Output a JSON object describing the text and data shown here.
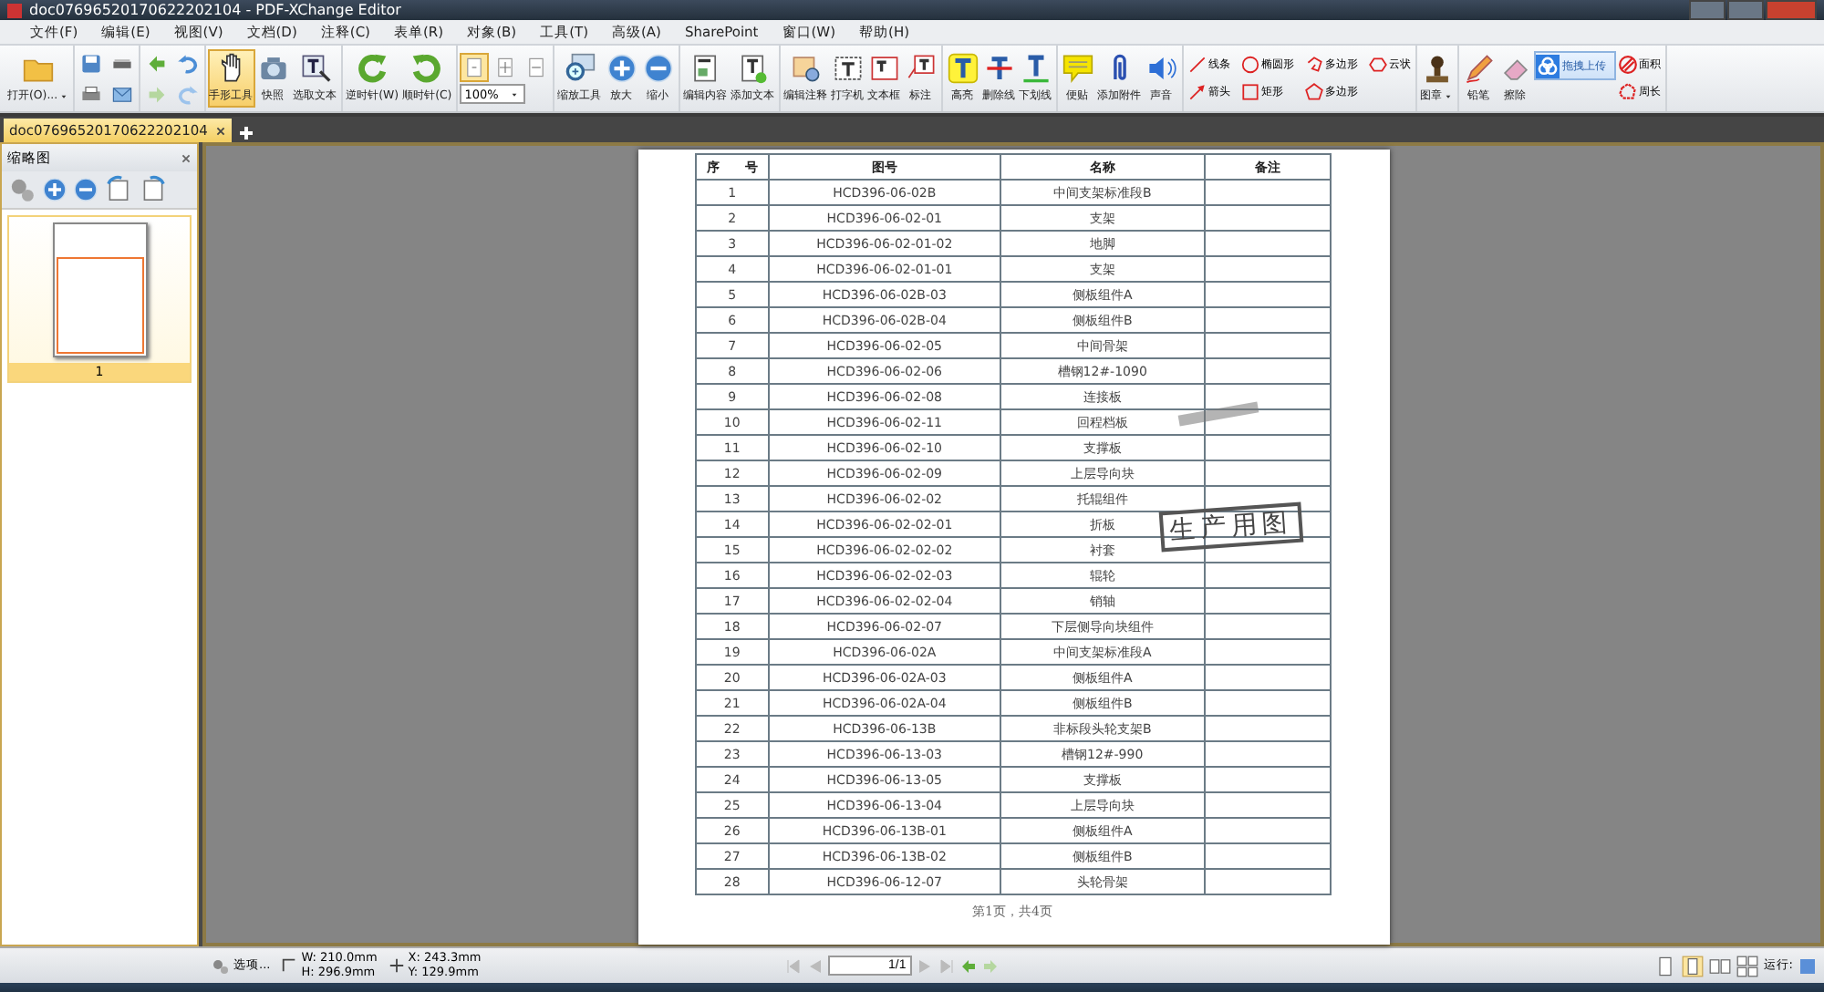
{
  "window": {
    "title": "doc07696520170622202104 - PDF-XChange Editor"
  },
  "menu": [
    "文件(F)",
    "编辑(E)",
    "视图(V)",
    "文档(D)",
    "注释(C)",
    "表单(R)",
    "对象(B)",
    "工具(T)",
    "高级(A)",
    "SharePoint",
    "窗口(W)",
    "帮助(H)"
  ],
  "toolbar": {
    "groups": [
      {
        "items": [
          {
            "kind": "large",
            "label": "打开(O)...",
            "selected": false
          }
        ]
      },
      {
        "items": [
          {
            "kind": "small",
            "selected": false
          },
          {
            "kind": "small",
            "selected": false
          },
          {
            "kind": "small",
            "selected": false
          },
          {
            "kind": "small",
            "selected": false
          }
        ]
      },
      {
        "items": [
          {
            "kind": "small",
            "selected": false
          },
          {
            "kind": "small",
            "selected": false
          },
          {
            "kind": "small",
            "selected": false
          },
          {
            "kind": "small",
            "selected": false
          }
        ]
      },
      {
        "items": [
          {
            "kind": "large",
            "label": "手形工具",
            "selected": true
          },
          {
            "kind": "large",
            "label": "快照",
            "selected": false
          },
          {
            "kind": "large",
            "label": "选取文本",
            "selected": false
          }
        ]
      },
      {
        "items": [
          {
            "kind": "large",
            "label": "逆时针(W)",
            "selected": false
          },
          {
            "kind": "large",
            "label": "顺时针(C)",
            "selected": false
          }
        ]
      },
      {
        "items": [
          {
            "kind": "small",
            "selected": true
          },
          {
            "kind": "small",
            "selected": false
          },
          {
            "kind": "small",
            "selected": false
          },
          {
            "kind": "select",
            "value": "100%"
          }
        ]
      },
      {
        "items": [
          {
            "kind": "large",
            "label": "缩放工具",
            "selected": false
          },
          {
            "kind": "large",
            "label": "放大",
            "selected": false
          },
          {
            "kind": "large",
            "label": "缩小",
            "selected": false
          }
        ]
      },
      {
        "items": [
          {
            "kind": "large",
            "label": "编辑内容",
            "selected": false
          },
          {
            "kind": "large",
            "label": "添加文本",
            "selected": false
          }
        ]
      },
      {
        "items": [
          {
            "kind": "large",
            "label": "编辑注释",
            "selected": false
          },
          {
            "kind": "large",
            "label": "打字机",
            "selected": false
          },
          {
            "kind": "large",
            "label": "文本框",
            "selected": false
          },
          {
            "kind": "large",
            "label": "标注",
            "selected": false
          }
        ]
      },
      {
        "items": [
          {
            "kind": "large",
            "label": "高亮",
            "selected": false
          },
          {
            "kind": "large",
            "label": "删除线",
            "selected": false
          },
          {
            "kind": "large",
            "label": "下划线",
            "selected": false
          }
        ]
      },
      {
        "items": [
          {
            "kind": "large",
            "label": "便贴",
            "selected": false
          },
          {
            "kind": "large",
            "label": "添加附件",
            "selected": false
          },
          {
            "kind": "large",
            "label": "声音",
            "selected": false
          }
        ]
      },
      {
        "items": [
          {
            "kind": "mini",
            "label": "线条",
            "selected": false
          },
          {
            "kind": "mini",
            "label": "箭头",
            "selected": false
          },
          {
            "kind": "mini",
            "label": "椭圆形",
            "selected": false
          },
          {
            "kind": "mini",
            "label": "矩形",
            "selected": false
          },
          {
            "kind": "mini",
            "label": "多边形",
            "selected": false
          },
          {
            "kind": "mini",
            "label": "多边形",
            "selected": false
          },
          {
            "kind": "mini",
            "label": "云状",
            "selected": false
          }
        ]
      },
      {
        "items": [
          {
            "kind": "large",
            "label": "图章",
            "selected": false
          }
        ]
      },
      {
        "items": [
          {
            "kind": "large",
            "label": "铅笔",
            "selected": false
          },
          {
            "kind": "large",
            "label": "擦除",
            "selected": false
          },
          {
            "kind": "upload",
            "label": "拖拽上传"
          },
          {
            "kind": "mini",
            "label": "面积",
            "selected": false
          },
          {
            "kind": "mini",
            "label": "周长",
            "selected": false
          }
        ]
      }
    ]
  },
  "tabs": [
    {
      "label": "doc07696520170622202104",
      "selected": true
    }
  ],
  "thumbnails": {
    "title": "缩略图",
    "pages": [
      {
        "label": "1",
        "selected": true
      }
    ]
  },
  "document": {
    "columns": [
      "序　　号",
      "图号",
      "名称",
      "备注"
    ],
    "rows": [
      [
        "1",
        "HCD396-06-02B",
        "中间支架标准段B"
      ],
      [
        "2",
        "HCD396-06-02-01",
        "支架"
      ],
      [
        "3",
        "HCD396-06-02-01-02",
        "地脚"
      ],
      [
        "4",
        "HCD396-06-02-01-01",
        "支架"
      ],
      [
        "5",
        "HCD396-06-02B-03",
        "侧板组件A"
      ],
      [
        "6",
        "HCD396-06-02B-04",
        "侧板组件B"
      ],
      [
        "7",
        "HCD396-06-02-05",
        "中间骨架"
      ],
      [
        "8",
        "HCD396-06-02-06",
        "槽钢12#-1090"
      ],
      [
        "9",
        "HCD396-06-02-08",
        "连接板"
      ],
      [
        "10",
        "HCD396-06-02-11",
        "回程档板"
      ],
      [
        "11",
        "HCD396-06-02-10",
        "支撑板"
      ],
      [
        "12",
        "HCD396-06-02-09",
        "上层导向块"
      ],
      [
        "13",
        "HCD396-06-02-02",
        "托辊组件"
      ],
      [
        "14",
        "HCD396-06-02-02-01",
        "折板"
      ],
      [
        "15",
        "HCD396-06-02-02-02",
        "衬套"
      ],
      [
        "16",
        "HCD396-06-02-02-03",
        "辊轮"
      ],
      [
        "17",
        "HCD396-06-02-02-04",
        "销轴"
      ],
      [
        "18",
        "HCD396-06-02-07",
        "下层侧导向块组件"
      ],
      [
        "19",
        "HCD396-06-02A",
        "中间支架标准段A"
      ],
      [
        "20",
        "HCD396-06-02A-03",
        "侧板组件A"
      ],
      [
        "21",
        "HCD396-06-02A-04",
        "侧板组件B"
      ],
      [
        "22",
        "HCD396-06-13B",
        "非标段头轮支架B"
      ],
      [
        "23",
        "HCD396-06-13-03",
        "槽钢12#-990"
      ],
      [
        "24",
        "HCD396-06-13-05",
        "支撑板"
      ],
      [
        "25",
        "HCD396-06-13-04",
        "上层导向块"
      ],
      [
        "26",
        "HCD396-06-13B-01",
        "侧板组件A"
      ],
      [
        "27",
        "HCD396-06-13B-02",
        "侧板组件B"
      ],
      [
        "28",
        "HCD396-06-12-07",
        "头轮骨架"
      ]
    ],
    "stamp": "生产用图",
    "footer": "第1页，共4页"
  },
  "status_bar": {
    "options": "选项...",
    "width": "W: 210.0mm",
    "height": "H: 296.9mm",
    "x": "X: 243.3mm",
    "y": "Y: 129.9mm",
    "page": "1/1",
    "zoom_label": "运行:"
  }
}
